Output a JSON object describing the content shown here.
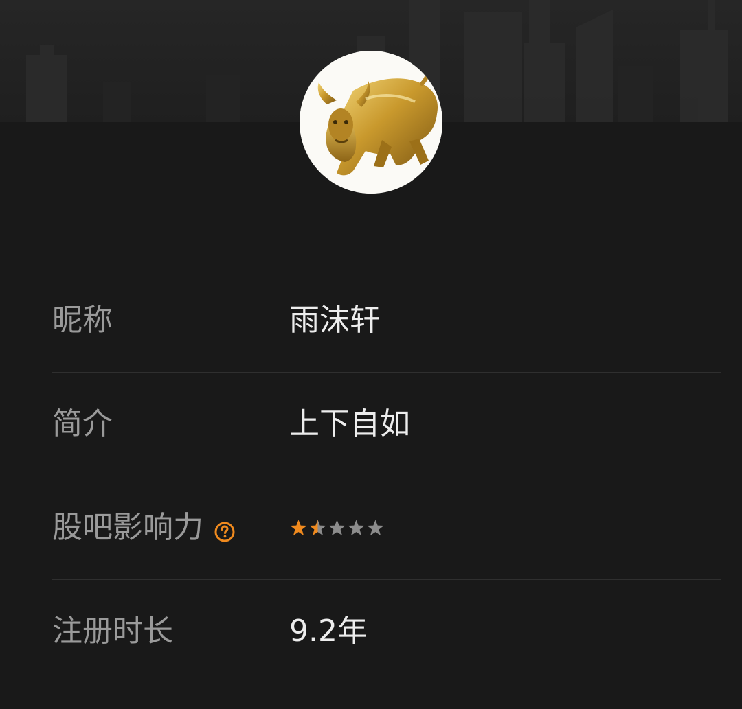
{
  "profile": {
    "avatar_icon": "golden-bull-icon",
    "rows": [
      {
        "label": "昵称",
        "value": "雨沫轩"
      },
      {
        "label": "简介",
        "value": "上下自如"
      },
      {
        "label": "股吧影响力",
        "help_icon": "question-circle-icon",
        "rating": 1.5,
        "rating_max": 5
      },
      {
        "label": "注册时长",
        "value": "9.2年"
      }
    ]
  },
  "colors": {
    "background": "#191919",
    "label": "#9a9a9a",
    "value": "#ededed",
    "accent": "#f08a1e",
    "star_empty": "#8c8c8c",
    "divider": "#2f2f2f"
  }
}
